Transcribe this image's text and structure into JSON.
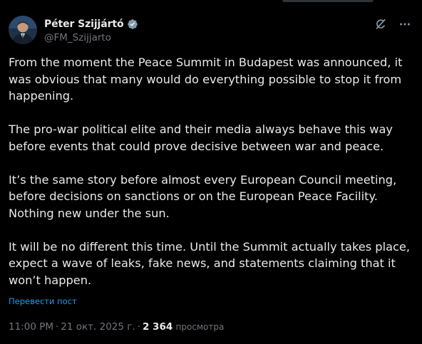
{
  "author": {
    "display_name": "Péter Szijjártó",
    "handle": "@FM_Szijjarto",
    "verified_icon": "verified-badge-icon",
    "avatar_icon": "avatar"
  },
  "actions": {
    "grok_icon": "grok-icon",
    "more_icon": "more-icon"
  },
  "tweet": {
    "paragraphs": [
      "From the moment the Peace Summit in Budapest was announced, it was obvious that many would do everything possible to stop it from happening.",
      "The pro-war political elite and their media always behave this way before events that could prove decisive between war and peace.",
      "It’s the same story before almost every European Council meeting, before decisions on sanctions or on the European Peace Facility. Nothing new under the sun.",
      "It will be no different this time. Until the Summit actually takes place, expect a wave of leaks, fake news, and statements claiming that it won’t happen."
    ],
    "translate_label": "Перевести пост"
  },
  "meta": {
    "time": "11:00 PM",
    "date": "21 окт. 2025 г.",
    "separator": "·",
    "views_count": "2 364",
    "views_label": "просмотра"
  },
  "colors": {
    "background": "#000000",
    "text": "#e7e9ea",
    "secondary": "#71767b",
    "link": "#1d9bf0",
    "verified": "#1d9bf0"
  }
}
